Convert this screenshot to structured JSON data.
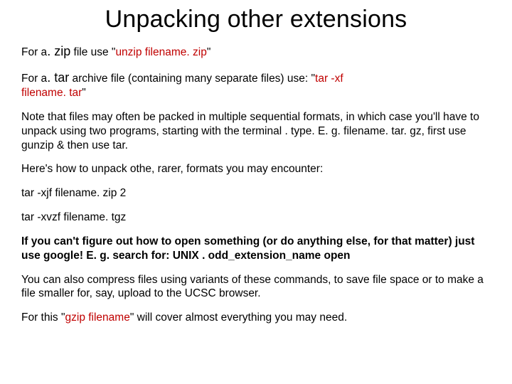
{
  "title": "Unpacking other extensions",
  "p1": {
    "a": "For a",
    "ext": ". zip",
    "b": " file use \"",
    "cmd": "unzip filename. zip",
    "c": "\""
  },
  "p2": {
    "a": "For a",
    "ext": ". tar",
    "b": " archive file (containing many separate files) use: \"",
    "cmd1": "tar -xf",
    "cmd2": "filename. tar",
    "c": "\""
  },
  "p3": "Note that files may often be packed in multiple sequential formats, in which case you'll have to unpack using two programs, starting with the terminal . type. E. g. filename. tar. gz, first use gunzip & then use tar.",
  "p4": "Here's how to unpack othe, rarer, formats you may encounter:",
  "p5": "tar -xjf filename. zip 2",
  "p6": "tar -xvzf filename. tgz",
  "p7": "If you can't figure out how to open something (or do anything else, for that matter) just use google! E. g. search for: UNIX . odd_extension_name open",
  "p8": "You can also compress files using variants of these commands, to save file space or to make a file smaller for, say, upload to the UCSC browser.",
  "p9": {
    "a": "For this \"",
    "cmd": "gzip filename",
    "b": "\" will cover almost everything you may need."
  }
}
